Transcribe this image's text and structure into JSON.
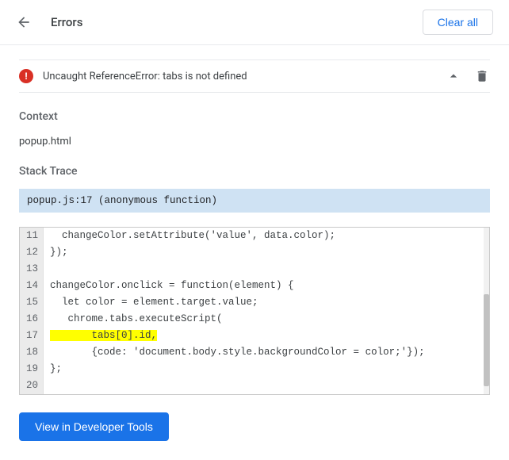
{
  "header": {
    "title": "Errors",
    "clear_all": "Clear all"
  },
  "error": {
    "message": "Uncaught ReferenceError: tabs is not defined"
  },
  "context": {
    "label": "Context",
    "value": "popup.html"
  },
  "trace": {
    "label": "Stack Trace",
    "banner": "popup.js:17 (anonymous function)"
  },
  "code": {
    "highlight_line": 17,
    "lines": [
      {
        "num": 11,
        "text": "  changeColor.setAttribute('value', data.color);"
      },
      {
        "num": 12,
        "text": "});"
      },
      {
        "num": 13,
        "text": ""
      },
      {
        "num": 14,
        "text": "changeColor.onclick = function(element) {"
      },
      {
        "num": 15,
        "text": "  let color = element.target.value;"
      },
      {
        "num": 16,
        "text": "   chrome.tabs.executeScript("
      },
      {
        "num": 17,
        "text": "       tabs[0].id,"
      },
      {
        "num": 18,
        "text": "       {code: 'document.body.style.backgroundColor = color;'});"
      },
      {
        "num": 19,
        "text": "};"
      },
      {
        "num": 20,
        "text": ""
      }
    ]
  },
  "footer": {
    "devtools": "View in Developer Tools"
  }
}
